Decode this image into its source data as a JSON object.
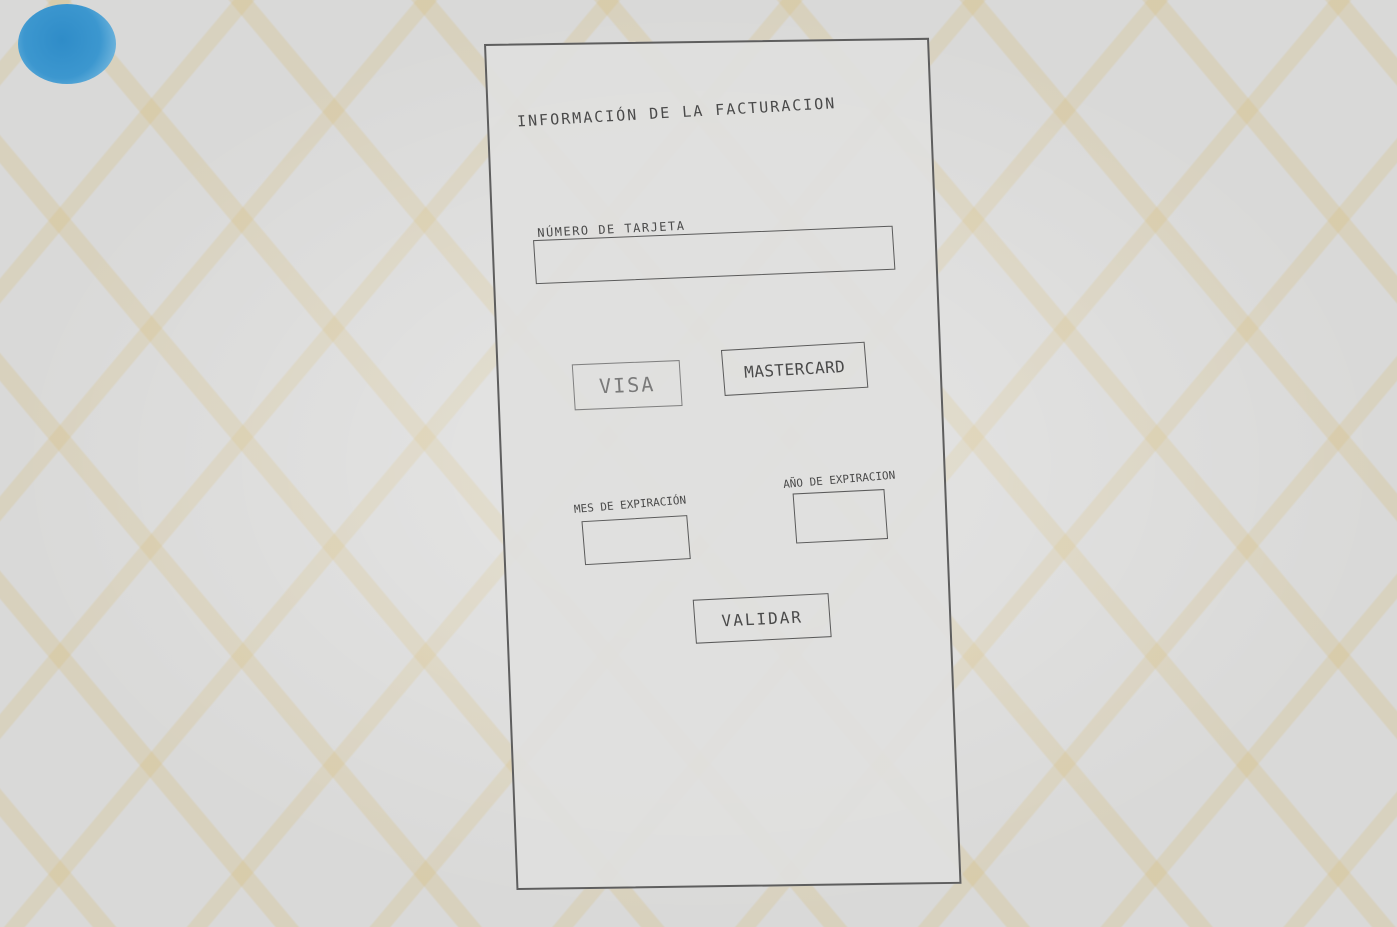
{
  "form": {
    "title": "INFORMACIÓN DE LA FACTURACION",
    "card_number_label": "NÚMERO DE TARJETA",
    "card_number_value": "",
    "visa_label": "VISA",
    "mastercard_label": "MASTERCARD",
    "month_label": "MES DE EXPIRACIÓN",
    "month_value": "",
    "year_label": "AÑO DE EXPIRACION",
    "year_value": "",
    "submit_label": "VALIDAR"
  },
  "colors": {
    "pencil": "#4a4a4a",
    "paper": "#d9d9d8",
    "marker_dot": "#2f8cc8",
    "stain": "#d6bc78"
  }
}
